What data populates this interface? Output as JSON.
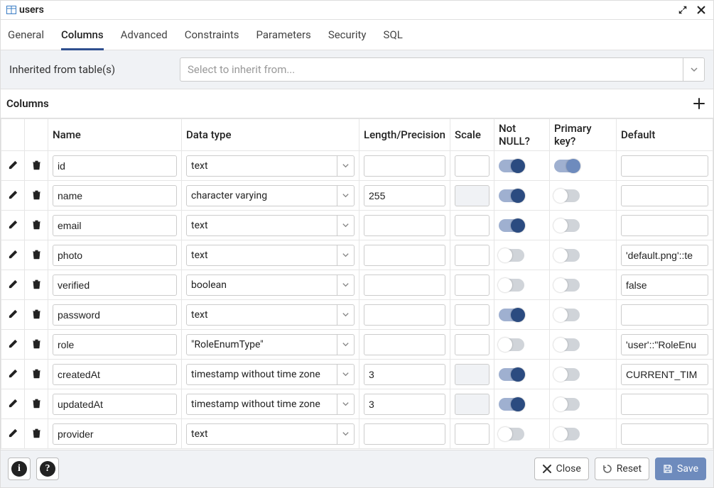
{
  "title": "users",
  "tabs": [
    "General",
    "Columns",
    "Advanced",
    "Constraints",
    "Parameters",
    "Security",
    "SQL"
  ],
  "active_tab": "Columns",
  "inherit": {
    "label": "Inherited from table(s)",
    "placeholder": "Select to inherit from..."
  },
  "columns_section": {
    "label": "Columns",
    "headers": {
      "name": "Name",
      "data_type": "Data type",
      "length": "Length/Precision",
      "scale": "Scale",
      "not_null": "Not NULL?",
      "primary_key": "Primary key?",
      "default": "Default"
    },
    "rows": [
      {
        "name": "id",
        "data_type": "text",
        "length": "",
        "scale": "",
        "scale_disabled": false,
        "not_null": true,
        "primary_key": true,
        "pk_light": true,
        "default": ""
      },
      {
        "name": "name",
        "data_type": "character varying",
        "length": "255",
        "scale": "",
        "scale_disabled": true,
        "not_null": true,
        "primary_key": false,
        "default": ""
      },
      {
        "name": "email",
        "data_type": "text",
        "length": "",
        "scale": "",
        "scale_disabled": false,
        "not_null": true,
        "primary_key": false,
        "default": ""
      },
      {
        "name": "photo",
        "data_type": "text",
        "length": "",
        "scale": "",
        "scale_disabled": false,
        "not_null": false,
        "primary_key": false,
        "default": "'default.png'::te"
      },
      {
        "name": "verified",
        "data_type": "boolean",
        "length": "",
        "scale": "",
        "scale_disabled": false,
        "not_null": false,
        "primary_key": false,
        "default": "false"
      },
      {
        "name": "password",
        "data_type": "text",
        "length": "",
        "scale": "",
        "scale_disabled": false,
        "not_null": true,
        "primary_key": false,
        "default": ""
      },
      {
        "name": "role",
        "data_type": "\"RoleEnumType\"",
        "length": "",
        "scale": "",
        "scale_disabled": false,
        "not_null": false,
        "primary_key": false,
        "default": "'user'::\"RoleEnu"
      },
      {
        "name": "createdAt",
        "data_type": "timestamp without time zone",
        "length": "3",
        "scale": "",
        "scale_disabled": true,
        "not_null": true,
        "primary_key": false,
        "default": "CURRENT_TIM"
      },
      {
        "name": "updatedAt",
        "data_type": "timestamp without time zone",
        "length": "3",
        "scale": "",
        "scale_disabled": true,
        "not_null": true,
        "primary_key": false,
        "default": ""
      },
      {
        "name": "provider",
        "data_type": "text",
        "length": "",
        "scale": "",
        "scale_disabled": false,
        "not_null": false,
        "primary_key": false,
        "default": ""
      }
    ]
  },
  "footer": {
    "close": "Close",
    "reset": "Reset",
    "save": "Save"
  }
}
